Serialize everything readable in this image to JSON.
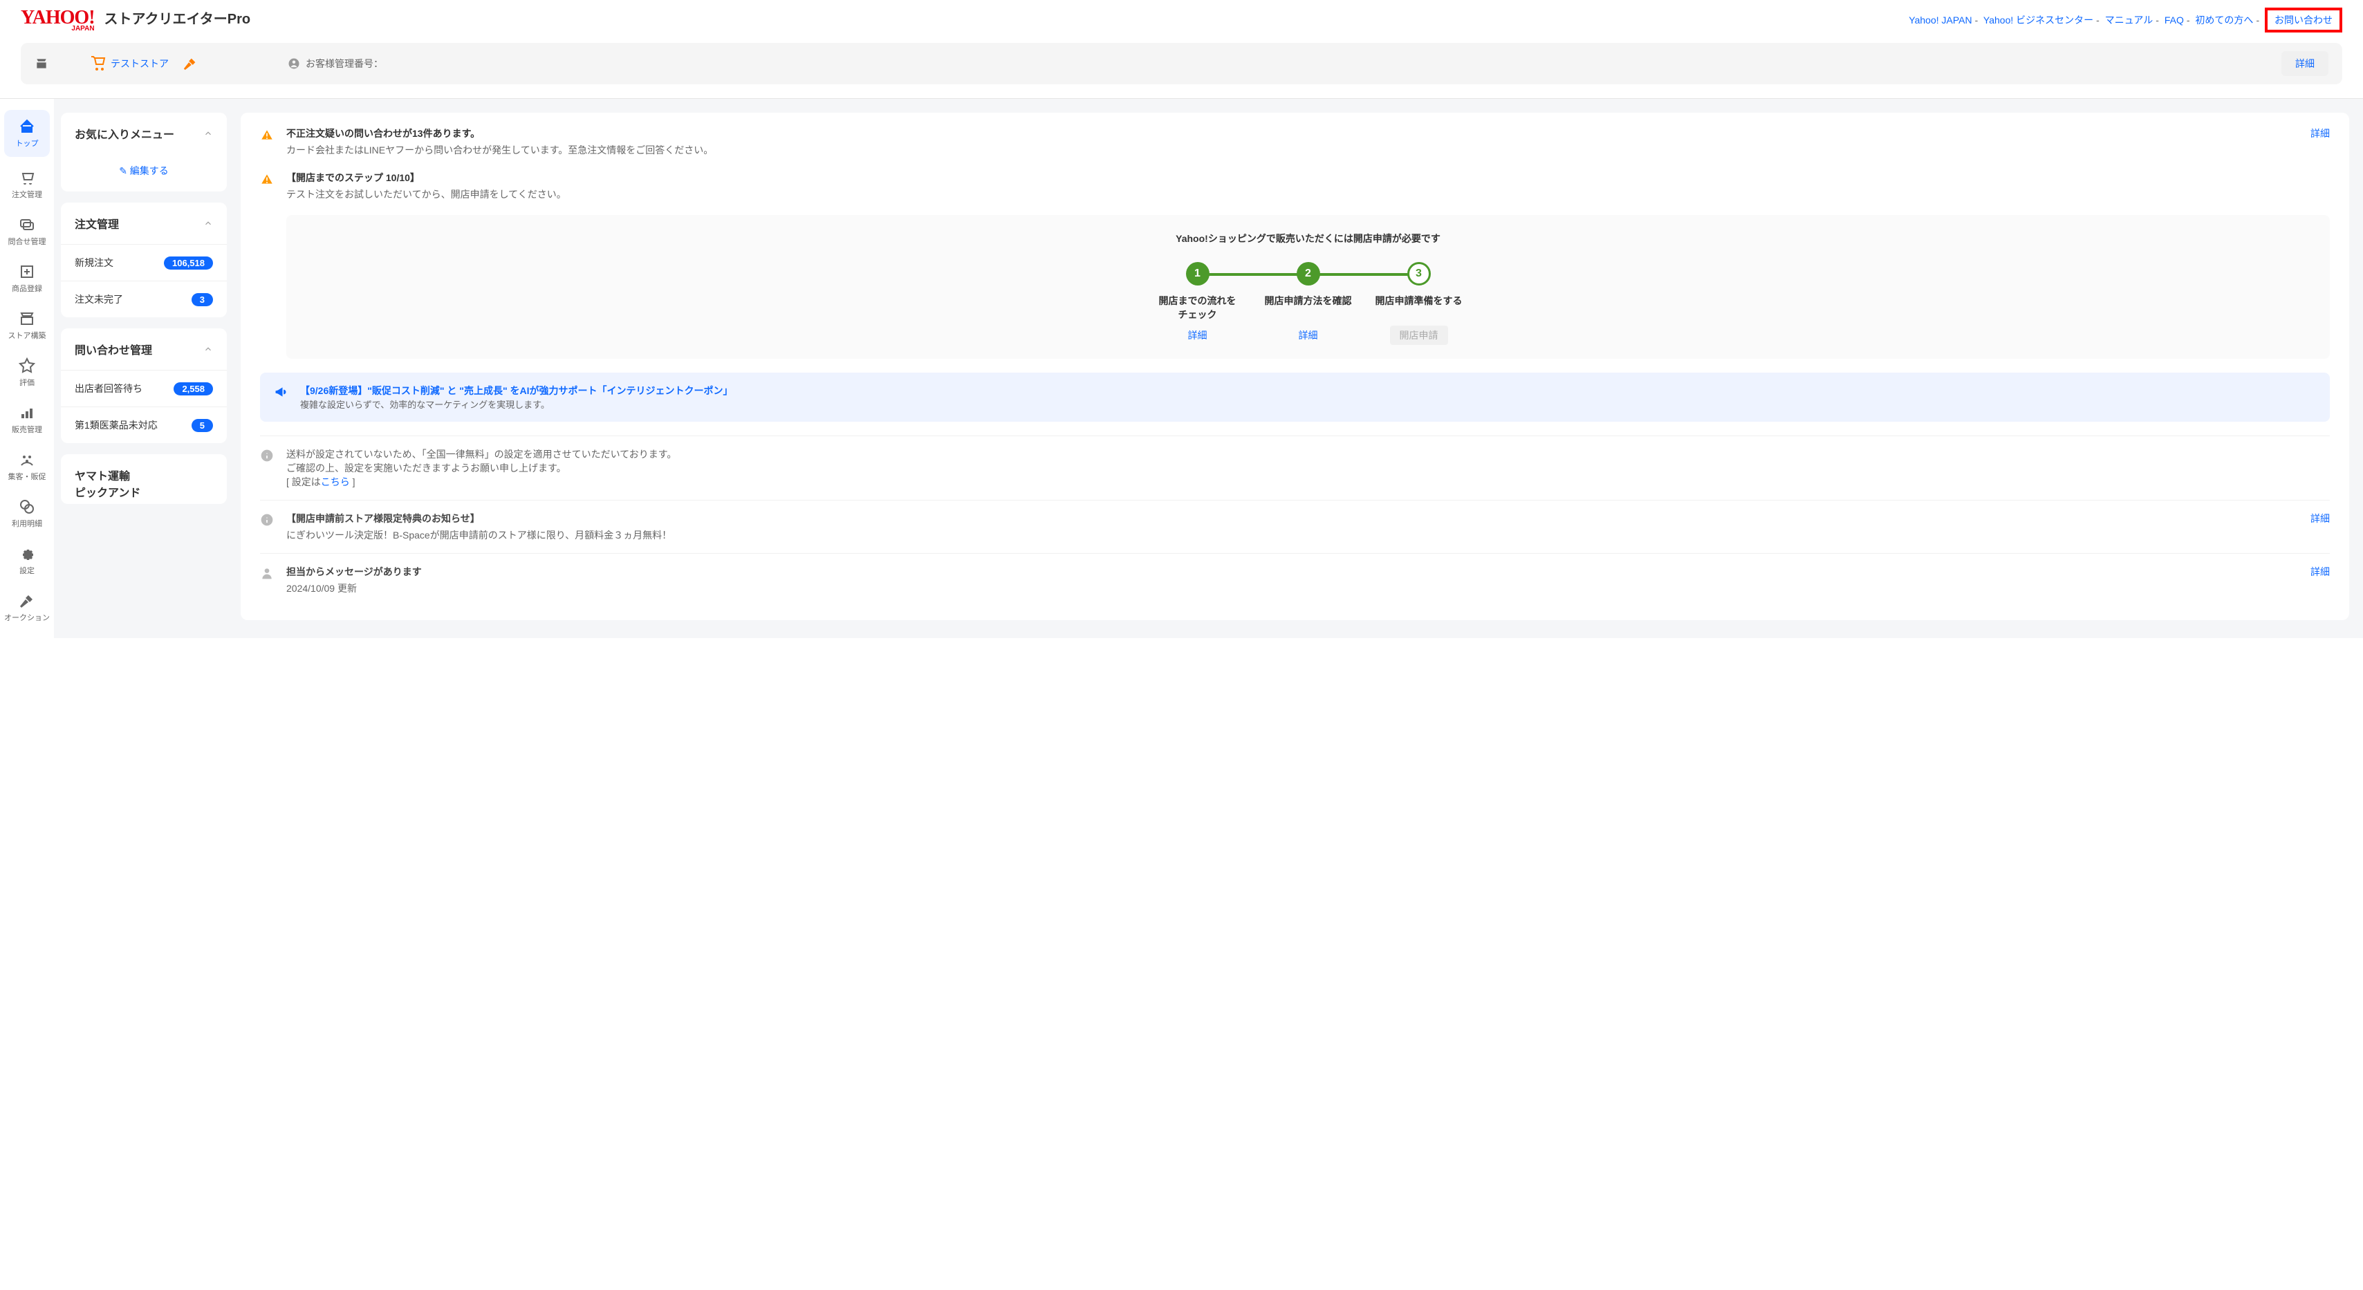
{
  "header": {
    "logo": "YAHOO!",
    "logo_sub": "JAPAN",
    "app_title": "ストアクリエイターPro",
    "links": [
      "Yahoo! JAPAN",
      "Yahoo! ビジネスセンター",
      "マニュアル",
      "FAQ",
      "初めての方へ",
      "お問い合わせ"
    ]
  },
  "subheader": {
    "store_name": "テストストア",
    "customer_label": "お客様管理番号：",
    "detail": "詳細"
  },
  "sidebar": [
    "トップ",
    "注文管理",
    "問合せ管理",
    "商品登録",
    "ストア構築",
    "評価",
    "販売管理",
    "集客・販促",
    "利用明細",
    "設定",
    "オークション"
  ],
  "left": {
    "favorites": {
      "title": "お気に入りメニュー",
      "edit": "✎ 編集する"
    },
    "orders": {
      "title": "注文管理",
      "rows": [
        {
          "label": "新規注文",
          "count": "106,518"
        },
        {
          "label": "注文未完了",
          "count": "3"
        }
      ]
    },
    "inquiries": {
      "title": "問い合わせ管理",
      "rows": [
        {
          "label": "出店者回答待ち",
          "count": "2,558"
        },
        {
          "label": "第1類医薬品未対応",
          "count": "5"
        }
      ]
    },
    "yamato": {
      "title": "ヤマト運輸\nピックアンド"
    }
  },
  "main": {
    "alert1": {
      "title": "不正注文疑いの問い合わせが13件あります。",
      "sub": "カード会社またはLINEヤフーから問い合わせが発生しています。至急注文情報をご回答ください。",
      "detail": "詳細"
    },
    "alert2": {
      "title": "【開店までのステップ 10/10】",
      "sub": "テスト注文をお試しいただいてから、開店申請をしてください。"
    },
    "steps": {
      "title": "Yahoo!ショッピングで販売いただくには開店申請が必要です",
      "items": [
        {
          "num": "1",
          "label": "開店までの流れを\nチェック",
          "action": "詳細"
        },
        {
          "num": "2",
          "label": "開店申請方法を確認",
          "action": "詳細"
        },
        {
          "num": "3",
          "label": "開店申請準備をする",
          "action": "開店申請"
        }
      ]
    },
    "promo": {
      "title": "【9/26新登場】\"販促コスト削減\" と \"売上成長\" をAIが強力サポート「インテリジェントクーポン」",
      "sub": "複雑な設定いらずで、効率的なマーケティングを実現します。"
    },
    "info1": {
      "l1": "送料が設定されていないため、「全国一律無料」の設定を適用させていただいております。",
      "l2": "ご確認の上、設定を実施いただきますようお願い申し上げます。",
      "l3a": "[ 設定は",
      "l3b": "こちら",
      "l3c": " ]"
    },
    "info2": {
      "title": "【開店申請前ストア様限定特典のお知らせ】",
      "sub": "にぎわいツール決定版！B-Spaceが開店申請前のストア様に限り、月額料金３ヵ月無料！",
      "detail": "詳細"
    },
    "info3": {
      "title": "担当からメッセージがあります",
      "sub": "2024/10/09 更新",
      "detail": "詳細"
    }
  }
}
